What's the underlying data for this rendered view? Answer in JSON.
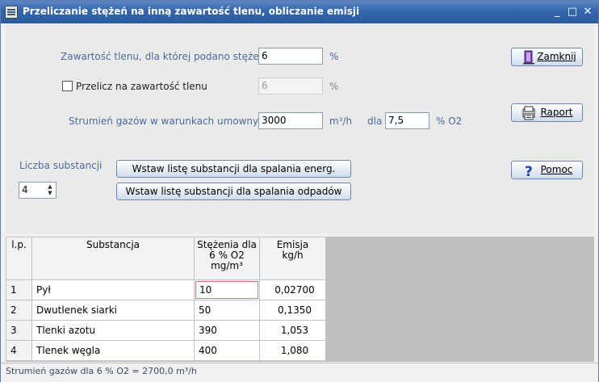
{
  "window": {
    "title": "Przeliczanie stężeń na inną zawartość tlenu, obliczanie emisji",
    "icon": "app-icon",
    "controls": {
      "minimize": "_",
      "maximize": "□",
      "close": "✕"
    }
  },
  "form": {
    "oxygen_label": "Zawartość tlenu, dla której podano stężenia",
    "oxygen_value": "6",
    "oxygen_unit": "%",
    "recalc_label": "Przelicz na zawartość tlenu",
    "recalc_checked": false,
    "recalc_value": "6",
    "recalc_unit": "%",
    "flow_label": "Strumień gazów w warunkach umownych",
    "flow_value": "3000",
    "flow_unit": "m³/h",
    "flow_for_label": "dla",
    "flow_o2_value": "7,5",
    "flow_o2_unit": "% O2",
    "count_label": "Liczba substancji",
    "count_value": "4",
    "insert_energy_label": "Wstaw listę substancji dla spalania energ.",
    "insert_waste_label": "Wstaw listę substancji dla spalania odpadów"
  },
  "buttons": {
    "close_label": "Zamknij",
    "report_label": "Raport",
    "help_label": "Pomoc"
  },
  "table": {
    "headers": {
      "lp": "l.p.",
      "substance": "Substancja",
      "conc_line1": "Stężenia dla",
      "conc_line2": "6 % O2",
      "conc_line3": "mg/m³",
      "emission_line1": "Emisja",
      "emission_line2": "kg/h"
    },
    "rows": [
      {
        "lp": "1",
        "substance": "Pył",
        "concentration": "10",
        "emission": "0,02700"
      },
      {
        "lp": "2",
        "substance": "Dwutlenek siarki",
        "concentration": "50",
        "emission": "0,1350"
      },
      {
        "lp": "3",
        "substance": "Tlenki azotu",
        "concentration": "390",
        "emission": "1,053"
      },
      {
        "lp": "4",
        "substance": "Tlenek węgla",
        "concentration": "400",
        "emission": "1,080"
      }
    ]
  },
  "status": {
    "text": "Strumień gazów dla 6 % O2 = 2700,0 m³/h"
  },
  "colors": {
    "title_bar": "#3466ad",
    "label_blue": "#4b6b9b",
    "grid_bg": "#bfbfbf"
  }
}
